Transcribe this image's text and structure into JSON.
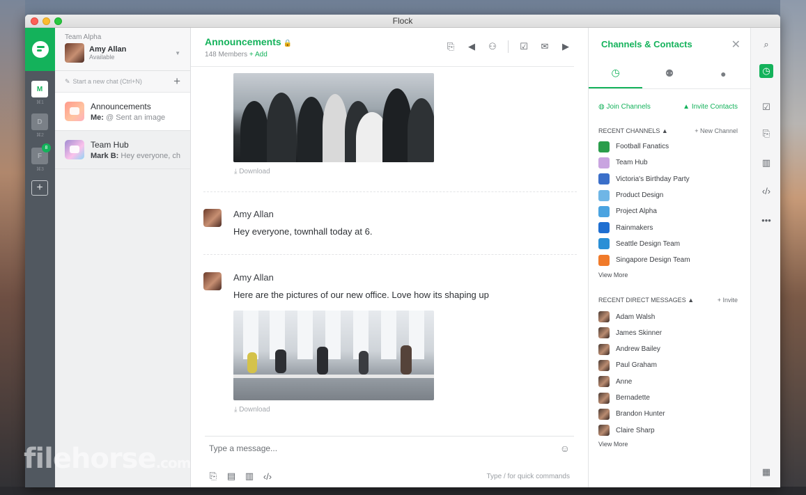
{
  "window": {
    "title": "Flock"
  },
  "rail": {
    "teams": [
      {
        "letter": "M",
        "shortcut": "⌘1"
      },
      {
        "letter": "D",
        "shortcut": "⌘2"
      },
      {
        "letter": "F",
        "shortcut": "⌘3",
        "badge": "8"
      }
    ],
    "add_label": "+"
  },
  "profile": {
    "team_name": "Team Alpha",
    "name": "Amy Allan",
    "status": "Available"
  },
  "new_chat": {
    "placeholder": "Start a new chat (Ctrl+N)",
    "plus": "+"
  },
  "conversations": [
    {
      "title": "Announcements",
      "sender": "Me:",
      "preview": "@ Sent an image"
    },
    {
      "title": "Team Hub",
      "sender": "Mark B:",
      "preview": "Hey everyone, ch..."
    }
  ],
  "channel": {
    "title": "Announcements",
    "lock": "🔒",
    "members": "148 Members",
    "add": "+ Add"
  },
  "messages": [
    {
      "sender": "Amy Allan",
      "text": "Hey everyone, townhall today at 6."
    },
    {
      "sender": "Amy Allan",
      "text": "Here are the pictures of our new office. Love how its shaping up"
    }
  ],
  "download_label": "Download",
  "composer": {
    "placeholder": "Type a message...",
    "hint": "Type  /  for quick commands"
  },
  "panel": {
    "title": "Channels & Contacts",
    "join": "Join Channels",
    "invite_contacts": "Invite Contacts",
    "recent_channels_label": "RECENT CHANNELS ▲",
    "new_channel": "+ New Channel",
    "channels": [
      {
        "name": "Football Fanatics",
        "color": "#2a9d4b"
      },
      {
        "name": "Team Hub",
        "color": "#c9a4e0"
      },
      {
        "name": "Victoria's Birthday Party",
        "color": "#3b6fc9"
      },
      {
        "name": "Product Design",
        "color": "#6fb6e6"
      },
      {
        "name": "Project Alpha",
        "color": "#4aa3e0"
      },
      {
        "name": "Rainmakers",
        "color": "#1f6fd1"
      },
      {
        "name": "Seattle Design Team",
        "color": "#2a8fd6"
      },
      {
        "name": "Singapore Design Team",
        "color": "#f07a2a"
      }
    ],
    "view_more": "View More",
    "recent_dm_label": "RECENT DIRECT MESSAGES ▲",
    "invite": "+ Invite",
    "contacts": [
      "Adam Walsh",
      "James Skinner",
      "Andrew Bailey",
      "Paul Graham",
      "Anne",
      "Bernadette",
      "Brandon Hunter",
      "Claire Sharp"
    ],
    "view_more_2": "View More"
  },
  "watermark": {
    "text": "filehorse",
    "suffix": ".com"
  },
  "colors": {
    "accent": "#14b25b",
    "rail": "#515860"
  }
}
